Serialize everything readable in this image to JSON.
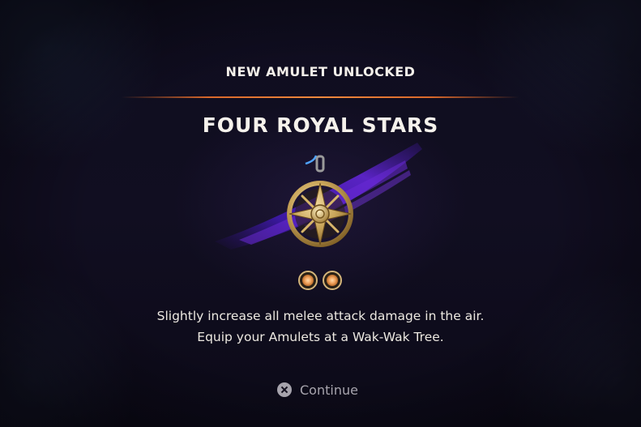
{
  "popup": {
    "header": "NEW AMULET UNLOCKED",
    "amulet_name": "FOUR ROYAL STARS",
    "amulet_icon": "four-royal-stars-amulet-icon",
    "slot_cost": 2,
    "description_line1": "Slightly increase all melee attack damage in the air.",
    "description_line2": "Equip your Amulets at a Wak-Wak Tree."
  },
  "prompt": {
    "button_icon": "cross-button-icon",
    "label": "Continue"
  },
  "colors": {
    "accent_orange": "#e37a35",
    "brush_purple": "#4a1fb0",
    "amulet_gold": "#c9a55a",
    "text": "#f1ede6",
    "muted_text": "#a7a4ad"
  }
}
